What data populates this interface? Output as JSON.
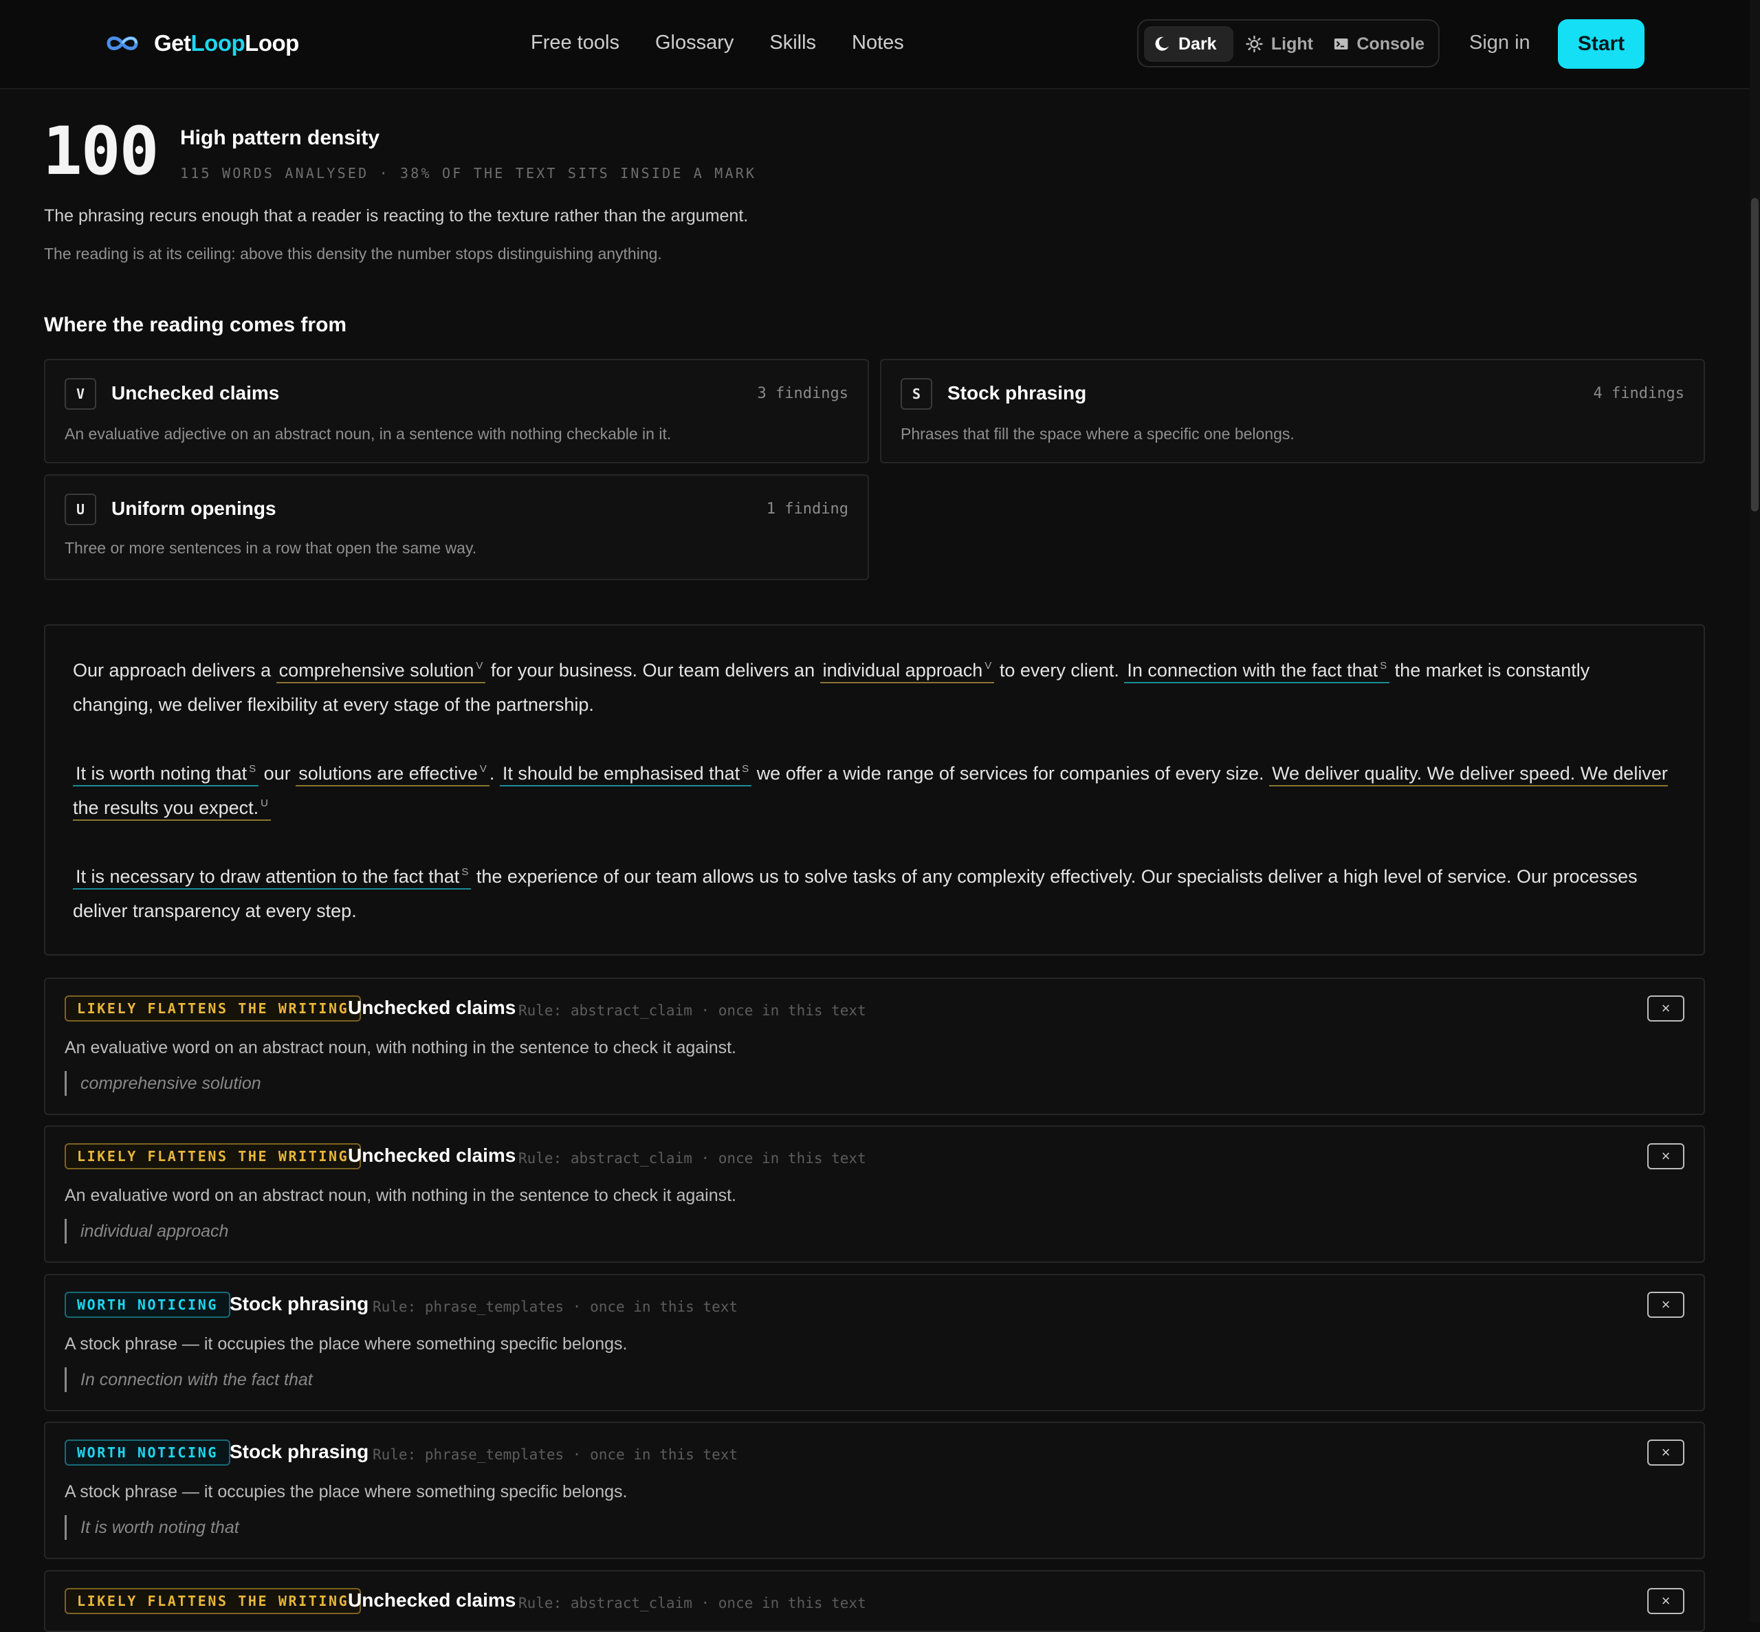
{
  "brand": {
    "prefix": "Get",
    "accent": "Loop",
    "suffix": "Loop"
  },
  "nav": [
    "Free tools",
    "Glossary",
    "Skills",
    "Notes"
  ],
  "theme": {
    "dark": "Dark",
    "light": "Light",
    "console": "Console",
    "selected": "Dark"
  },
  "auth": {
    "sign_in": "Sign in",
    "start": "Start"
  },
  "score": {
    "value": "100",
    "title": "High pattern density",
    "meta": "115 WORDS ANALYSED · 38% OF THE TEXT SITS INSIDE A MARK",
    "summary": "The phrasing recurs enough that a reader is reacting to the texture rather than the argument.",
    "note": "The reading is at its ceiling: above this density the number stops distinguishing anything."
  },
  "breakdown": {
    "title": "Where the reading comes from",
    "categories": [
      {
        "badge": "V",
        "title": "Unchecked claims",
        "count": "3 findings",
        "desc": "An evaluative adjective on an abstract noun, in a sentence with nothing checkable in it."
      },
      {
        "badge": "S",
        "title": "Stock phrasing",
        "count": "4 findings",
        "desc": "Phrases that fill the space where a specific one belongs."
      },
      {
        "badge": "U",
        "title": "Uniform openings",
        "count": "1 finding",
        "desc": "Three or more sentences in a row that open the same way."
      }
    ]
  },
  "text": {
    "p1": {
      "t1": "Our approach delivers a",
      "m1": "comprehensive solution",
      "s1": "V",
      "t2": "for your business. Our team delivers an",
      "m2": "individual approach",
      "s2": "V",
      "t3": "to every client.",
      "m3": "In connection with the fact that",
      "s3": "S",
      "t4": "the market is constantly changing, we deliver flexibility at every stage of the partnership."
    },
    "p2": {
      "m1": "It is worth noting that",
      "s1": "S",
      "t1": "our",
      "m2": "solutions are effective",
      "s2": "V",
      "t2": ".",
      "m3": "It should be emphasised that",
      "s3": "S",
      "t3": "we offer a wide range of services for companies of every size.",
      "m4": "We deliver quality. We deliver speed. We deliver the results you expect.",
      "s4": "U"
    },
    "p3": {
      "m1": "It is necessary to draw attention to the fact that",
      "s1": "S",
      "t1": "the experience of our team allows us to solve tasks of any complexity effectively. Our specialists deliver a high level of service. Our processes deliver transparency at every step."
    }
  },
  "findings": [
    {
      "tag": "LIKELY FLATTENS THE WRITING",
      "title": "Unchecked claims",
      "rule": "Rule: abstract_claim · once in this text",
      "desc": "An evaluative word on an abstract noun, with nothing in the sentence to check it against.",
      "quote": "comprehensive solution",
      "close": "×"
    },
    {
      "tag": "LIKELY FLATTENS THE WRITING",
      "title": "Unchecked claims",
      "rule": "Rule: abstract_claim · once in this text",
      "desc": "An evaluative word on an abstract noun, with nothing in the sentence to check it against.",
      "quote": "individual approach",
      "close": "×"
    },
    {
      "tag": "WORTH NOTICING",
      "title": "Stock phrasing",
      "rule": "Rule: phrase_templates · once in this text",
      "desc": "A stock phrase — it occupies the place where something specific belongs.",
      "quote": "In connection with the fact that",
      "close": "×"
    },
    {
      "tag": "WORTH NOTICING",
      "title": "Stock phrasing",
      "rule": "Rule: phrase_templates · once in this text",
      "desc": "A stock phrase — it occupies the place where something specific belongs.",
      "quote": "It is worth noting that",
      "close": "×"
    },
    {
      "tag": "LIKELY FLATTENS THE WRITING",
      "title": "Unchecked claims",
      "rule": "Rule: abstract_claim · once in this text",
      "close": "×"
    }
  ],
  "colors": {
    "accent": "#15dff5",
    "amber": "#e8b63a",
    "background": "#0e0e0e"
  },
  "icons": {
    "logo": "infinity-icon",
    "dark": "moon-icon",
    "light": "sun-icon",
    "console": "terminal-icon",
    "close": "close-icon"
  }
}
